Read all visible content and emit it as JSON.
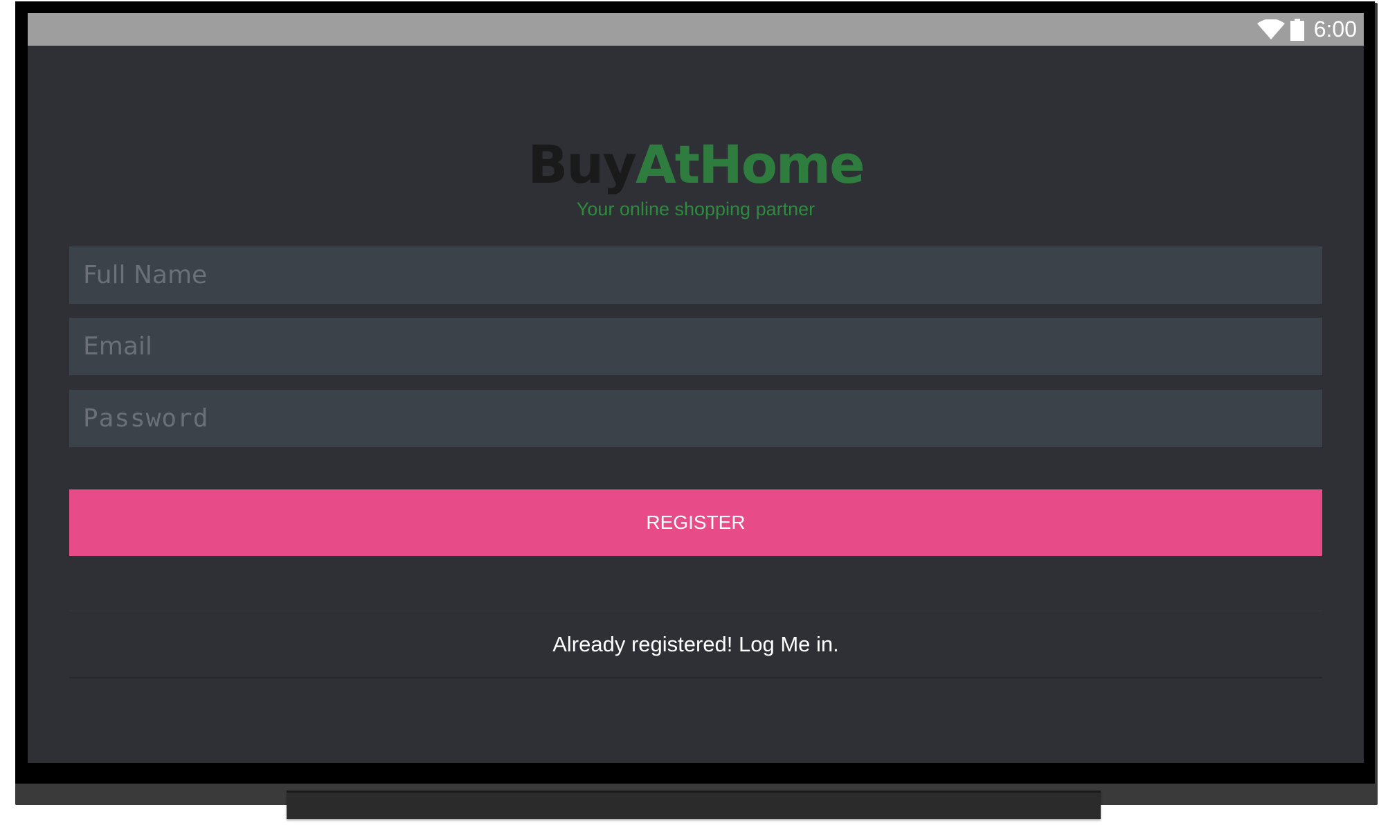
{
  "status_bar": {
    "time": "6:00",
    "wifi_icon": "wifi-icon",
    "battery_icon": "battery-icon"
  },
  "brand": {
    "part1": "Buy",
    "part2": "AtHome",
    "tagline": "Your online shopping partner"
  },
  "form": {
    "full_name_placeholder": "Full Name",
    "email_placeholder": "Email",
    "password_placeholder": "Password",
    "register_label": "REGISTER",
    "login_link_label": "Already registered! Log Me in."
  },
  "colors": {
    "screen_bg": "#2e3035",
    "field_bg": "#3b424a",
    "brand_dark": "#1a1a1a",
    "brand_green": "#2e7d3e",
    "accent_pink": "#e84c88",
    "status_bar": "#9e9e9e"
  }
}
